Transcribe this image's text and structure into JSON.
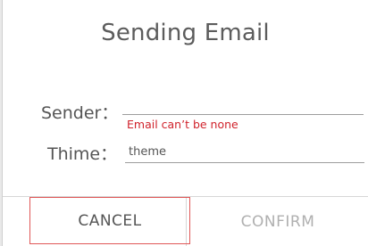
{
  "dialog": {
    "title": "Sending Email",
    "sender": {
      "label": "Sender：",
      "value": "",
      "error": "Email can’t be none"
    },
    "theme": {
      "label": "Thime：",
      "placeholder": "theme"
    },
    "buttons": {
      "cancel": "CANCEL",
      "confirm": "CONFIRM"
    }
  }
}
